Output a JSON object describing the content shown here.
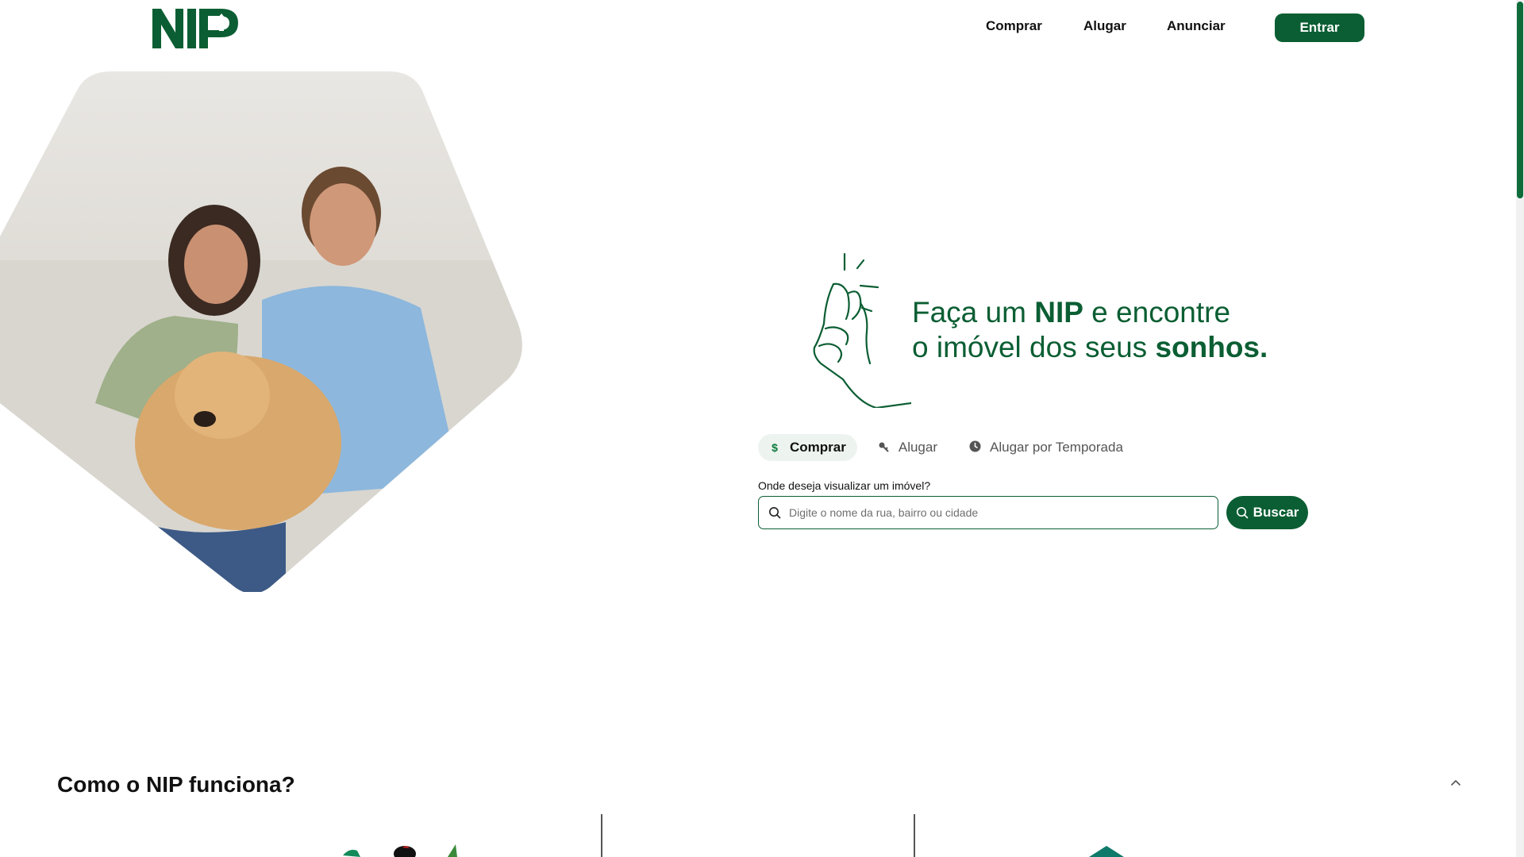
{
  "brand": {
    "name": "NIP",
    "primary_color": "#0b5e33"
  },
  "nav": {
    "comprar": "Comprar",
    "alugar": "Alugar",
    "anunciar": "Anunciar",
    "entrar": "Entrar"
  },
  "hero": {
    "headline_part1": "Faça um ",
    "headline_bold1": "NIP",
    "headline_part2": " e encontre",
    "headline_part3": "o imóvel dos seus ",
    "headline_bold2": "sonhos."
  },
  "search": {
    "tabs": [
      {
        "label": "Comprar",
        "icon": "dollar-icon",
        "active": true
      },
      {
        "label": "Alugar",
        "icon": "key-icon",
        "active": false
      },
      {
        "label": "Alugar por Temporada",
        "icon": "clock-icon",
        "active": false
      }
    ],
    "label": "Onde deseja visualizar um imóvel?",
    "placeholder": "Digite o nome da rua, bairro ou cidade",
    "value": "",
    "button": "Buscar"
  },
  "how_it_works": {
    "title": "Como o NIP funciona?"
  }
}
